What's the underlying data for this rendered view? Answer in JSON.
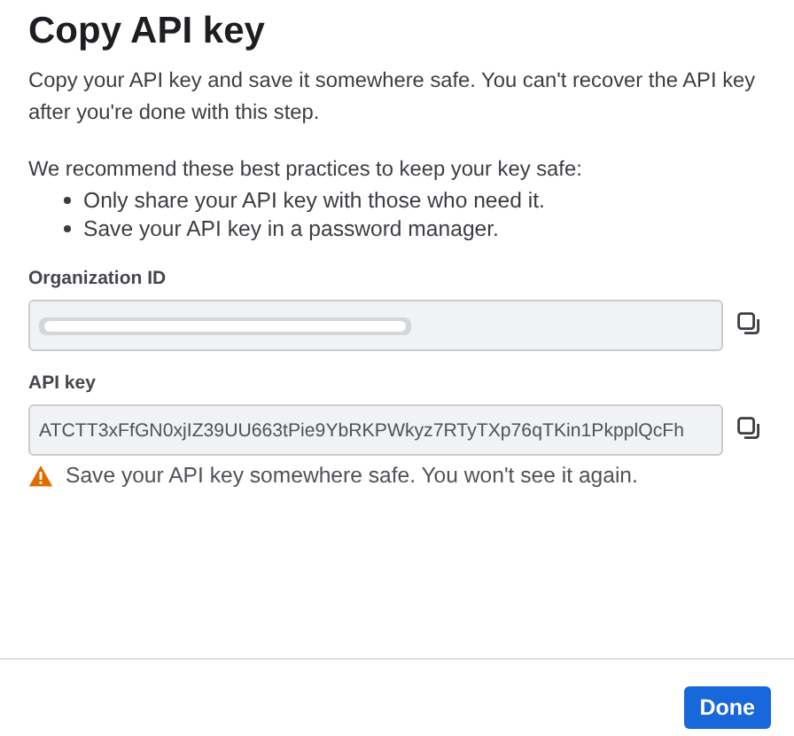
{
  "dialog": {
    "title": "Copy API key",
    "intro": "Copy your API key and save it somewhere safe. You can't recover the API key after you're done with this step.",
    "practices_heading": "We recommend these best practices to keep your key safe:",
    "practices": [
      "Only share your API key with those who need it.",
      "Save your API key in a password manager."
    ],
    "fields": [
      {
        "label": "Organization ID",
        "redacted": true
      },
      {
        "label": "API key",
        "redacted": false,
        "value": "ATCTT3xFfGN0xjIZ39UU663tPie9YbRKPWkyz7RTyTXp76qTKin1PkpplQcFh"
      }
    ],
    "warning": "Save your API key somewhere safe. You won't see it again.",
    "buttons": [
      {
        "label": "Done",
        "kind": "primary"
      }
    ]
  }
}
